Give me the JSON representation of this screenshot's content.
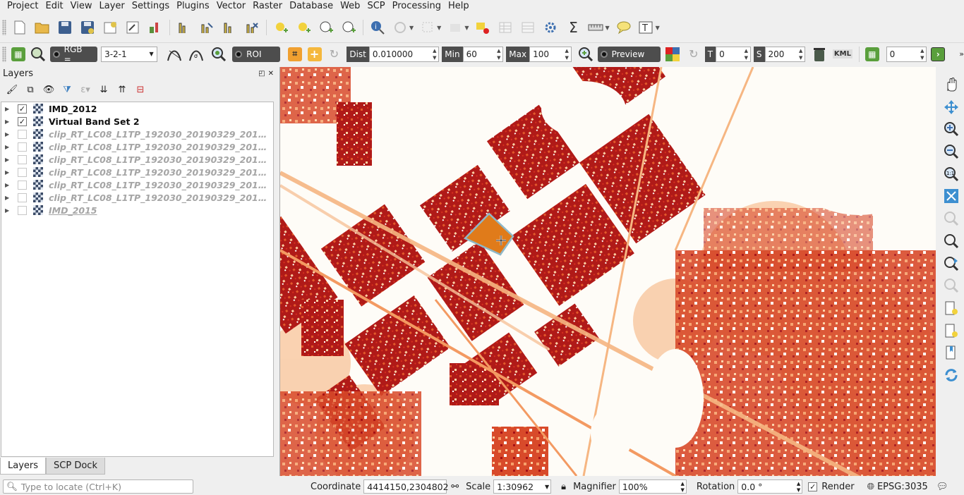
{
  "menubar": {
    "items": [
      "Project",
      "Edit",
      "View",
      "Layer",
      "Settings",
      "Plugins",
      "Vector",
      "Raster",
      "Database",
      "Web",
      "SCP",
      "Processing",
      "Help"
    ]
  },
  "scp_toolbar": {
    "rgb_label": "RGB =",
    "rgb_value": "3-2-1",
    "roi_label": "ROI",
    "dist_label": "Dist",
    "dist_value": "0.010000",
    "min_label": "Min",
    "min_value": "60",
    "max_label": "Max",
    "max_value": "100",
    "preview_label": "Preview",
    "t_label": "T",
    "t_value": "0",
    "s_label": "S",
    "s_value": "200",
    "kml_label": "KML",
    "band_value": "0"
  },
  "layers_panel": {
    "title": "Layers",
    "layers": [
      {
        "name": "IMD_2012",
        "checked": true
      },
      {
        "name": "Virtual Band Set 2",
        "checked": true
      },
      {
        "name": "clip_RT_LC08_L1TP_192030_20190329_20190...",
        "checked": false
      },
      {
        "name": "clip_RT_LC08_L1TP_192030_20190329_20190...",
        "checked": false
      },
      {
        "name": "clip_RT_LC08_L1TP_192030_20190329_20190...",
        "checked": false
      },
      {
        "name": "clip_RT_LC08_L1TP_192030_20190329_20190...",
        "checked": false
      },
      {
        "name": "clip_RT_LC08_L1TP_192030_20190329_20190...",
        "checked": false
      },
      {
        "name": "clip_RT_LC08_L1TP_192030_20190329_20190...",
        "checked": false
      },
      {
        "name": "IMD_2015",
        "checked": false
      }
    ],
    "tabs": [
      "Layers",
      "SCP Dock"
    ]
  },
  "statusbar": {
    "locator_placeholder": "Type to locate (Ctrl+K)",
    "coordinate_label": "Coordinate",
    "coordinate_value": "4414150,2304802",
    "scale_label": "Scale",
    "scale_value": "1:30962",
    "magnifier_label": "Magnifier",
    "magnifier_value": "100%",
    "rotation_label": "Rotation",
    "rotation_value": "0.0 °",
    "render_label": "Render",
    "crs_label": "EPSG:3035"
  },
  "colors": {
    "map_dark": "#a50f15",
    "map_mid": "#d7301f",
    "map_light": "#fdbb84",
    "map_bg": "#fefcf7",
    "roi_fill": "#e07b1a",
    "roi_stroke": "#8fb8c8"
  }
}
